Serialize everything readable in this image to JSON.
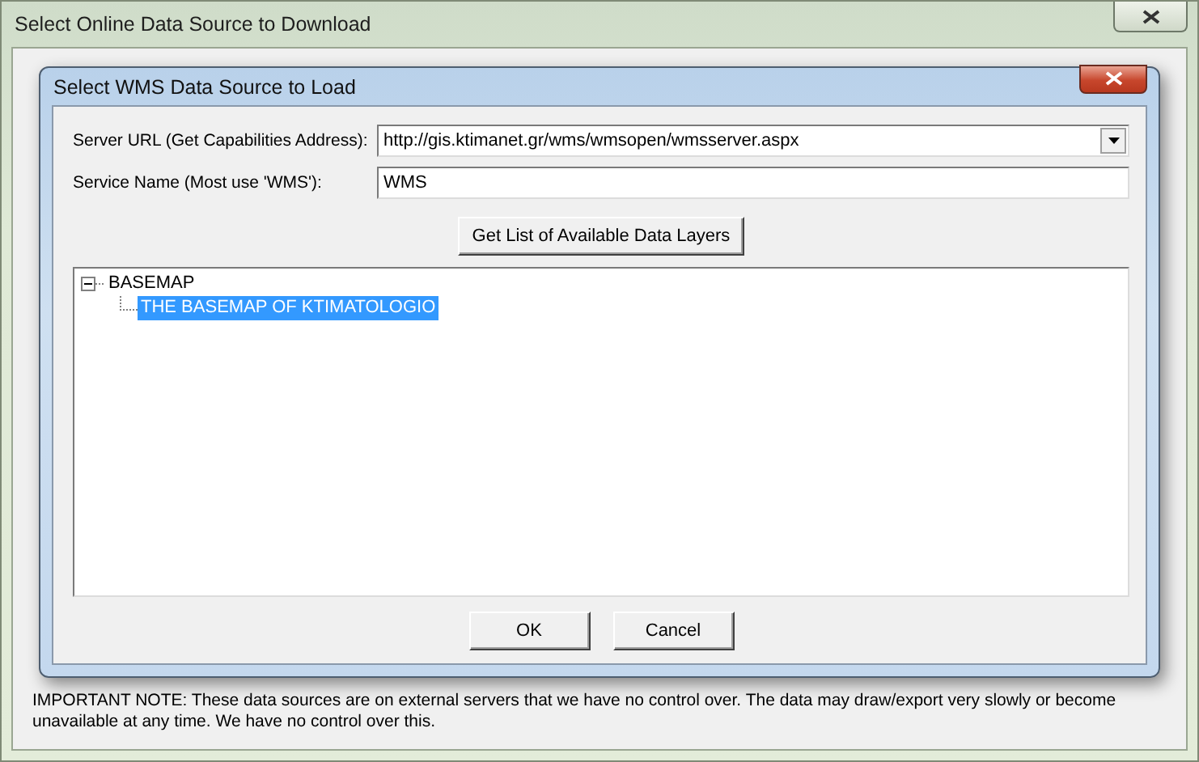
{
  "window": {
    "title": "Select Online Data Source to Download"
  },
  "note": "IMPORTANT NOTE: These data sources are on external servers that we have no control over. The data may draw/export very slowly or become unavailable at any time. We have no control over this.",
  "dialog": {
    "title": "Select WMS Data Source to Load",
    "server_url": {
      "label": "Server URL (Get Capabilities Address):",
      "value": "http://gis.ktimanet.gr/wms/wmsopen/wmsserver.aspx"
    },
    "service_name": {
      "label": "Service Name (Most use 'WMS'):",
      "value": "WMS"
    },
    "get_layers_button": "Get List of Available Data Layers",
    "tree": [
      {
        "label": "BASEMAP",
        "expanded": true,
        "selected": false,
        "children": [
          {
            "label": "THE BASEMAP OF KTIMATOLOGIO",
            "selected": true
          }
        ]
      }
    ],
    "buttons": [
      "OK",
      "Cancel"
    ]
  }
}
